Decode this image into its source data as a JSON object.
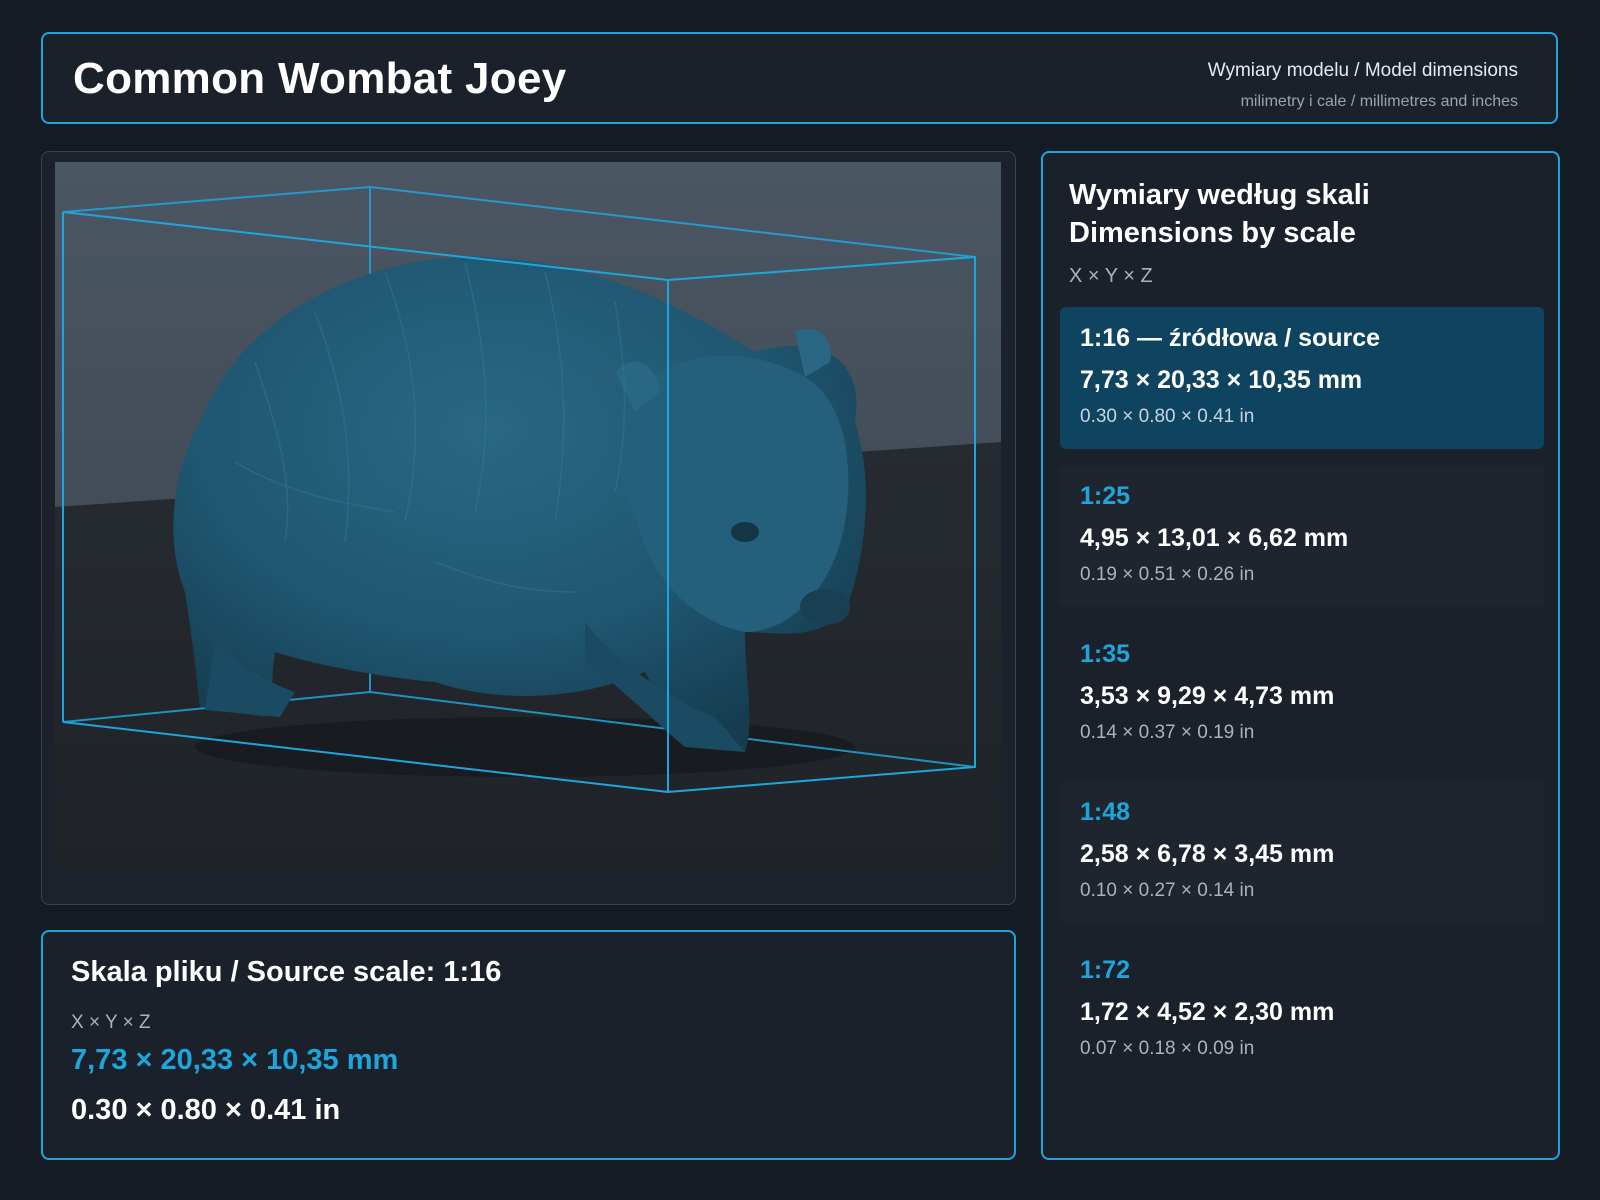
{
  "header": {
    "title": "Common Wombat Joey",
    "subtitle": "Wymiary modelu / Model dimensions",
    "units_note": "milimetry i cale / millimetres and inches"
  },
  "viewer": {
    "image": "3D render of wombat model inside bounding box",
    "bbox_color": "#1ea6dc",
    "model_color": "#1f5670"
  },
  "source": {
    "heading": "Skala pliku / Source scale: 1:16",
    "axis_label": "X × Y × Z",
    "mm": "7,73 × 20,33 × 10,35 mm",
    "inches": "0.30 × 0.80 × 0.41 in"
  },
  "scales_panel": {
    "title_pl": "Wymiary według skali",
    "title_en": "Dimensions by scale",
    "axis_label": "X × Y × Z",
    "rows": [
      {
        "scale": "1:16  —  źródłowa / source",
        "mm": "7,73 × 20,33 × 10,35 mm",
        "inches": "0.30 × 0.80 × 0.41 in"
      },
      {
        "scale": "1:25",
        "mm": "4,95 × 13,01 × 6,62 mm",
        "inches": "0.19 × 0.51 × 0.26 in"
      },
      {
        "scale": "1:35",
        "mm": "3,53 × 9,29 × 4,73 mm",
        "inches": "0.14 × 0.37 × 0.19 in"
      },
      {
        "scale": "1:48",
        "mm": "2,58 × 6,78 × 3,45 mm",
        "inches": "0.10 × 0.27 × 0.14 in"
      },
      {
        "scale": "1:72",
        "mm": "1,72 × 4,52 × 2,30 mm",
        "inches": "0.07 × 0.18 × 0.09 in"
      }
    ]
  },
  "colors": {
    "accent": "#1ea6dc",
    "active_row": "#0f4460",
    "background": "#151b25"
  }
}
